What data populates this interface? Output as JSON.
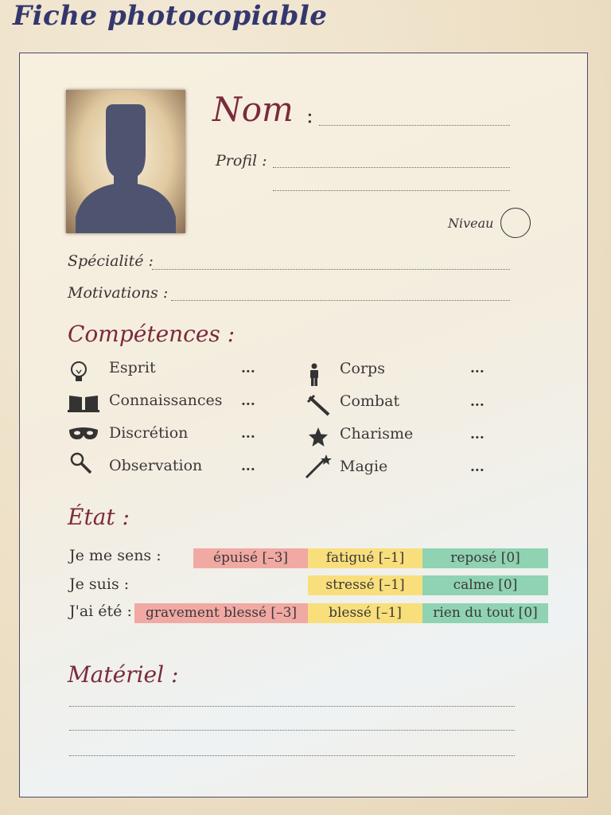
{
  "header": {
    "title": "Fiche photocopiable"
  },
  "identity": {
    "name_label": "Nom",
    "name_colon": ":",
    "profile_label": "Profil :",
    "level_label": "Niveau",
    "specialty_label": "Spécialité :",
    "motivations_label": "Motivations :"
  },
  "skills": {
    "heading": "Compétences :",
    "left": [
      {
        "label": "Esprit",
        "value": "...",
        "icon": "lightbulb-icon"
      },
      {
        "label": "Connaissances",
        "value": "...",
        "icon": "book-icon"
      },
      {
        "label": "Discrétion",
        "value": "...",
        "icon": "mask-icon"
      },
      {
        "label": "Observation",
        "value": "...",
        "icon": "magnifier-icon"
      }
    ],
    "right": [
      {
        "label": "Corps",
        "value": "...",
        "icon": "person-icon"
      },
      {
        "label": "Combat",
        "value": "...",
        "icon": "sword-icon"
      },
      {
        "label": "Charisme",
        "value": "...",
        "icon": "star-icon"
      },
      {
        "label": "Magie",
        "value": "...",
        "icon": "wand-icon"
      }
    ]
  },
  "state": {
    "heading": "État :",
    "rows": [
      {
        "label": "Je me sens :",
        "cells": [
          "épuisé [–3]",
          "fatigué [–1]",
          "reposé [0]"
        ]
      },
      {
        "label": "Je suis :",
        "cells": [
          "stressé [–1]",
          "calme [0]"
        ]
      },
      {
        "label": "J'ai été :",
        "cells": [
          "gravement blessé [–3]",
          "blessé [–1]",
          "rien du tout [0]"
        ]
      }
    ]
  },
  "equipment": {
    "heading": "Matériel :"
  },
  "colors": {
    "red": "#f1a9a4",
    "yellow": "#f9df7c",
    "green": "#8fd3b2",
    "title": "#34376e",
    "heading": "#7a2b3b"
  }
}
